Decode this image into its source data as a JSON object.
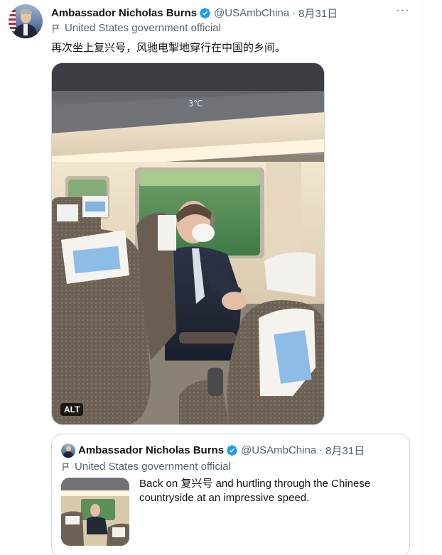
{
  "author": {
    "name": "Ambassador Nicholas Burns",
    "handle": "@USAmbChina",
    "separator": "·",
    "date": "8月31日",
    "label": "United States government official",
    "verified_color": "#1d9bf0"
  },
  "tweet": {
    "text": "再次坐上复兴号，风驰电掣地穿行在中国的乡间。",
    "more_label": "···",
    "media": {
      "alt_label": "ALT",
      "icon": "photo"
    }
  },
  "quote": {
    "author": {
      "name": "Ambassador Nicholas Burns",
      "handle": "@USAmbChina",
      "separator": "·",
      "date": "8月31日",
      "label": "United States government official"
    },
    "text": "Back on 复兴号 and hurtling through the Chinese countryside at an impressive speed."
  },
  "colors": {
    "text_primary": "#0f1419",
    "text_secondary": "#536471",
    "border": "#cfd9de",
    "accent": "#1d9bf0"
  }
}
